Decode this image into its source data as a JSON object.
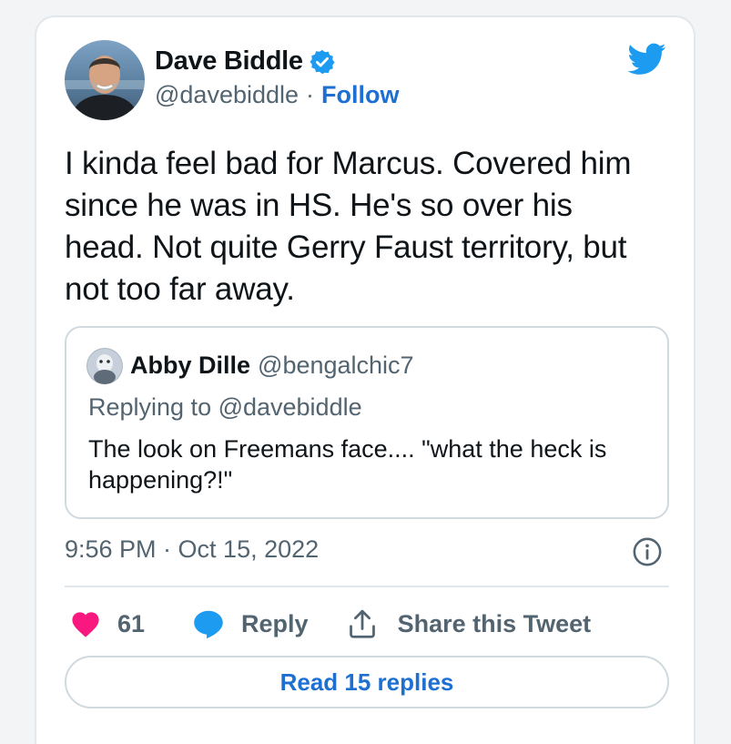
{
  "tweet": {
    "author": {
      "name": "Dave Biddle",
      "handle": "@davebiddle",
      "separator": "·",
      "follow_label": "Follow"
    },
    "text": "I kinda feel bad for Marcus. Covered him since he was in HS. He's so over his head. Not quite Gerry Faust territory, but not too far away.",
    "quoted": {
      "name": "Abby Dille",
      "handle": "@bengalchic7",
      "replying_to": "Replying to @davebiddle",
      "text": "The look on Freemans face.... \"what the heck is happening?!\""
    },
    "timestamp": "9:56 PM · Oct 15, 2022",
    "actions": {
      "like_count": "61",
      "reply_label": "Reply",
      "share_label": "Share this Tweet"
    },
    "read_replies_label": "Read 15 replies"
  },
  "icons": {
    "verified": "verified-badge-icon",
    "brand": "twitter-bird-icon",
    "info": "info-icon",
    "like": "heart-icon",
    "reply": "speech-bubble-icon",
    "share": "share-upload-icon"
  },
  "colors": {
    "accent": "#1d6fd2",
    "twitter_blue": "#1d9bf0",
    "like_red": "#f91880",
    "muted_text": "#536471"
  }
}
